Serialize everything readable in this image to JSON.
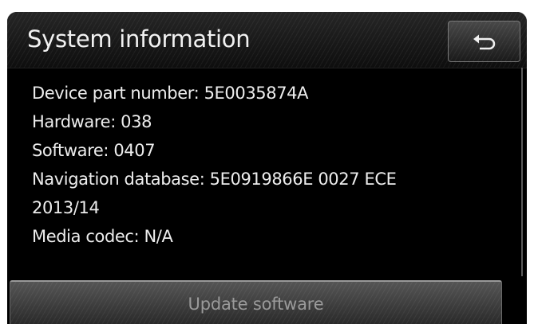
{
  "header": {
    "title": "System information",
    "back_icon": "back-arrow-icon"
  },
  "info": {
    "lines": [
      "Device part number: 5E0035874A",
      "Hardware: 038",
      "Software: 0407",
      "Navigation database: 5E0919866E 0027 ECE",
      "2013/14",
      "Media codec: N/A"
    ]
  },
  "actions": {
    "update_label": "Update software"
  },
  "colors": {
    "background": "#000000",
    "text": "#ededed",
    "disabled_text": "#9a9a9a"
  }
}
